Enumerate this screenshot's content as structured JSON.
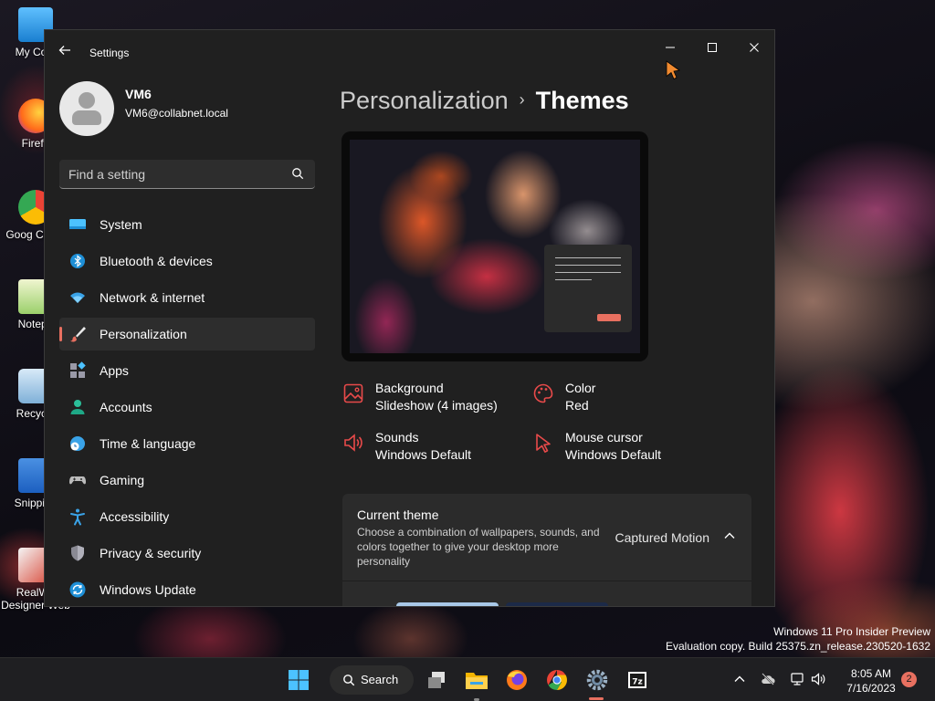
{
  "desktop": {
    "icons": [
      {
        "label": "My Com",
        "color": "#3aa0e8"
      },
      {
        "label": "Firefo",
        "color": "#ff7a1a"
      },
      {
        "label": "Goog Chron",
        "color": "#34a853"
      },
      {
        "label": "Notepa",
        "color": "#9bd06b"
      },
      {
        "label": "Recycle",
        "color": "#9fc4e8"
      },
      {
        "label": "Snipping",
        "color": "#2c74d8"
      },
      {
        "label": "RealWo Designer Web",
        "color": "#d84a3a"
      }
    ],
    "watermark": {
      "line1": "Windows 11 Pro Insider Preview",
      "line2": "Evaluation copy. Build 25375.zn_release.230520-1632"
    }
  },
  "window": {
    "app_title": "Settings",
    "controls": {
      "minimize": "—",
      "maximize": "☐",
      "close": "✕"
    }
  },
  "profile": {
    "name": "VM6",
    "email": "VM6@collabnet.local"
  },
  "search": {
    "placeholder": "Find a setting"
  },
  "nav": {
    "items": [
      {
        "label": "System",
        "icon": "system-icon"
      },
      {
        "label": "Bluetooth & devices",
        "icon": "bluetooth-icon"
      },
      {
        "label": "Network & internet",
        "icon": "wifi-icon"
      },
      {
        "label": "Personalization",
        "icon": "brush-icon",
        "active": true
      },
      {
        "label": "Apps",
        "icon": "apps-icon"
      },
      {
        "label": "Accounts",
        "icon": "accounts-icon"
      },
      {
        "label": "Time & language",
        "icon": "globe-clock-icon"
      },
      {
        "label": "Gaming",
        "icon": "gamepad-icon"
      },
      {
        "label": "Accessibility",
        "icon": "accessibility-icon"
      },
      {
        "label": "Privacy & security",
        "icon": "shield-icon"
      },
      {
        "label": "Windows Update",
        "icon": "update-icon"
      }
    ]
  },
  "breadcrumb": {
    "parent": "Personalization",
    "separator": "›",
    "current": "Themes"
  },
  "properties": {
    "background": {
      "title": "Background",
      "value": "Slideshow (4 images)"
    },
    "color": {
      "title": "Color",
      "value": "Red"
    },
    "sounds": {
      "title": "Sounds",
      "value": "Windows Default"
    },
    "mouse_cursor": {
      "title": "Mouse cursor",
      "value": "Windows Default"
    }
  },
  "current_theme": {
    "title": "Current theme",
    "description": "Choose a combination of wallpapers, sounds, and colors together to give your desktop more personality",
    "value": "Captured Motion"
  },
  "taskbar": {
    "search_label": "Search",
    "time": "8:05 AM",
    "date": "7/16/2023",
    "notification_count": "2"
  },
  "colors": {
    "accent": "#e87060",
    "window_bg": "#202020",
    "card_bg": "#2b2b2b"
  }
}
